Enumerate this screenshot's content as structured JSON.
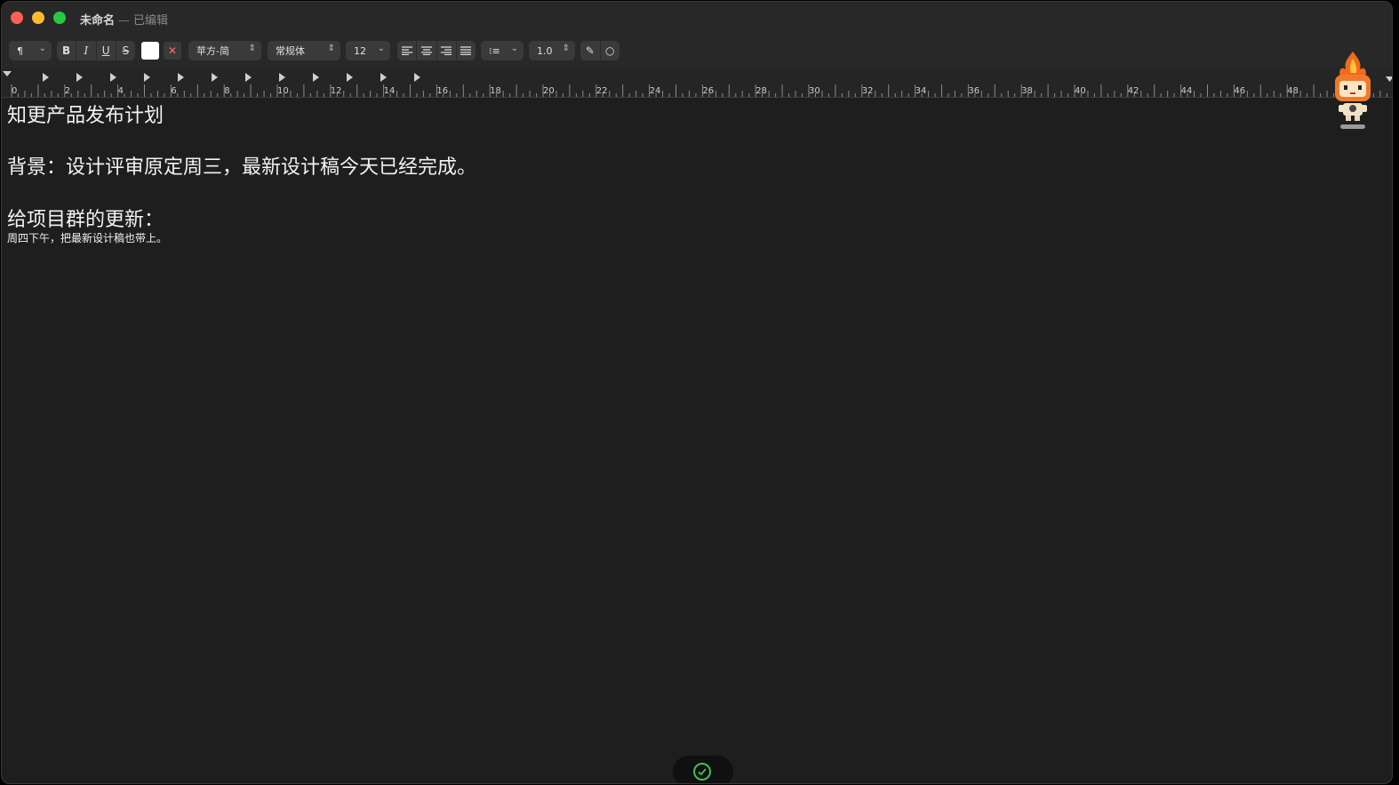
{
  "window": {
    "title": "未命名",
    "separator": "—",
    "status": "已编辑"
  },
  "toolbar": {
    "paragraph_style_icon": "¶",
    "bold_label": "B",
    "italic_label": "I",
    "underline_label": "U",
    "strike_label": "S",
    "text_color": "#ffffff",
    "font_family": "苹方-简",
    "font_style": "常规体",
    "font_size": "12",
    "line_spacing": "1.0"
  },
  "ruler": {
    "labels": [
      "0",
      "2",
      "4",
      "6",
      "8",
      "10",
      "12",
      "14",
      "16",
      "18",
      "20",
      "22",
      "24",
      "26",
      "28",
      "30",
      "32",
      "34",
      "36",
      "38",
      "40",
      "42",
      "44",
      "46",
      "48",
      "5"
    ]
  },
  "document": {
    "heading": "知更产品发布计划",
    "background_line": "背景：设计评审原定周三，最新设计稿今天已经完成。",
    "update_heading": "给项目群的更新：",
    "update_body": "周四下午，把最新设计稿也带上。"
  },
  "colors": {
    "close": "#ff5f57",
    "minimize": "#febc2e",
    "zoom": "#28c840",
    "check": "#3fbf5a"
  }
}
